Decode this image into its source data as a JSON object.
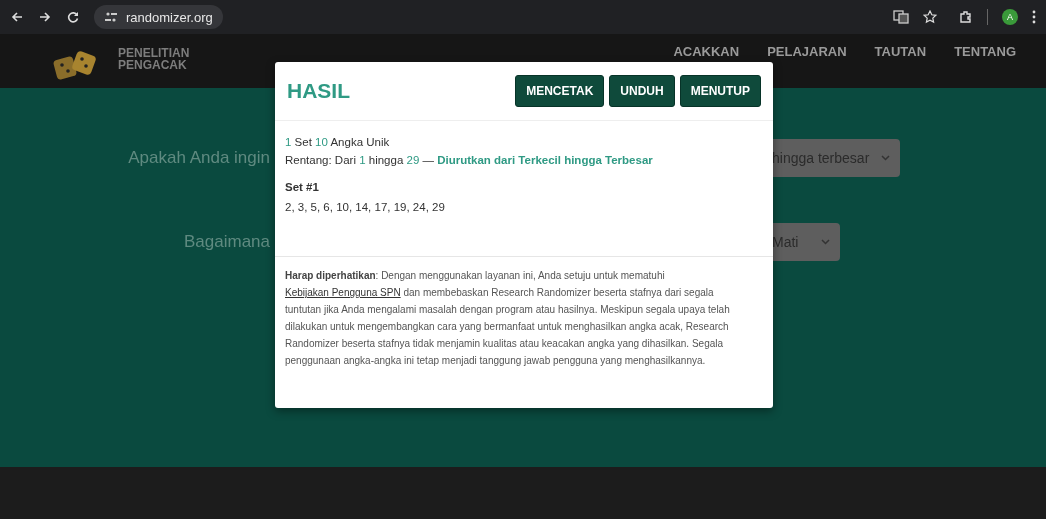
{
  "browser": {
    "url": "randomizer.org",
    "avatar": "A"
  },
  "site": {
    "logo_lines": [
      "PENELITIAN",
      "PENGACAK"
    ],
    "nav": [
      "ACAKKAN",
      "PELAJARAN",
      "TAUTAN",
      "TENTANG"
    ]
  },
  "background_questions": [
    {
      "label": "Apakah Anda ingin",
      "select_value": "hingga terbesar"
    },
    {
      "label": "Bagaimana",
      "select_value": "Mati"
    }
  ],
  "modal": {
    "title": "HASIL",
    "buttons": [
      "MENCETAK",
      "UNDUH",
      "MENUTUP"
    ],
    "summary_lines": [
      [
        {
          "text": "1",
          "kind": "number"
        },
        {
          "text": " Set ",
          "kind": "text"
        },
        {
          "text": "10",
          "kind": "number"
        },
        {
          "text": " Angka Unik",
          "kind": "text"
        }
      ],
      [
        {
          "text": "Rentang: Dari ",
          "kind": "text"
        },
        {
          "text": "1",
          "kind": "number"
        },
        {
          "text": " hingga ",
          "kind": "text"
        },
        {
          "text": "29",
          "kind": "number"
        },
        {
          "text": " — ",
          "kind": "text"
        },
        {
          "text": "Diurutkan dari Terkecil hingga Terbesar",
          "kind": "order"
        }
      ]
    ],
    "sets": [
      {
        "title": "Set #1",
        "numbers": "2, 3, 5, 6, 10, 14, 17, 19, 24, 29"
      }
    ],
    "notice": {
      "lead": "**Harap diperhatikan**: Dengan menggunakan layanan ini, Anda setuju untuk mematuhi",
      "link": "Kebijakan Pengguna SPN",
      "rest": "dan membebaskan Research Randomizer beserta stafnya dari segala tuntutan jika Anda mengalami masalah dengan program atau hasilnya. Meskipun segala upaya telah dilakukan untuk mengembangkan cara yang bermanfaat untuk menghasilkan angka acak, Research Randomizer beserta stafnya tidak menjamin kualitas atau keacakan angka yang dihasilkan. Segala penggunaan angka-angka ini tetap menjadi tanggung jawab pengguna yang menghasilkannya."
    }
  }
}
